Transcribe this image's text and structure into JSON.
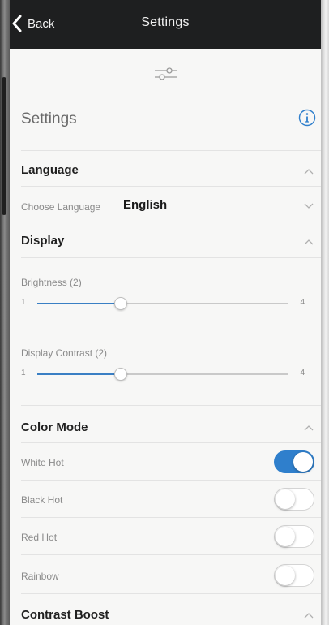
{
  "nav": {
    "back_label": "Back",
    "title": "Settings"
  },
  "header": {
    "title": "Settings"
  },
  "language": {
    "title": "Language",
    "choose_label": "Choose Language",
    "value": "English"
  },
  "display": {
    "title": "Display",
    "brightness": {
      "label": "Brightness (2)",
      "min": "1",
      "max": "4",
      "value": 2,
      "min_value": 1,
      "max_value": 4
    },
    "contrast": {
      "label": "Display Contrast (2)",
      "min": "1",
      "max": "4",
      "value": 2,
      "min_value": 1,
      "max_value": 4
    }
  },
  "color_mode": {
    "title": "Color Mode",
    "options": [
      {
        "label": "White Hot",
        "on": true
      },
      {
        "label": "Black Hot",
        "on": false
      },
      {
        "label": "Red Hot",
        "on": false
      },
      {
        "label": "Rainbow",
        "on": false
      }
    ]
  },
  "contrast_boost": {
    "title": "Contrast Boost"
  },
  "colors": {
    "accent": "#2f7fcc",
    "navbar": "#1e1f20",
    "background": "#f7f7f6"
  }
}
